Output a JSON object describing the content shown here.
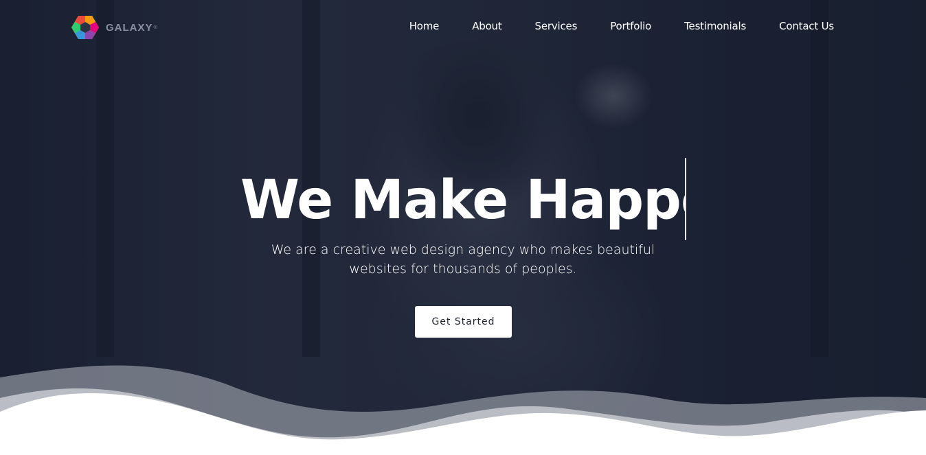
{
  "brand": {
    "name": "GALAXY",
    "registered_mark": "®"
  },
  "nav": {
    "items": [
      {
        "label": "Home"
      },
      {
        "label": "About"
      },
      {
        "label": "Services"
      },
      {
        "label": "Portfolio"
      },
      {
        "label": "Testimonials"
      },
      {
        "label": "Contact Us"
      }
    ]
  },
  "hero": {
    "headline": "We Make Happe",
    "subtitle_line1": "We are a creative web design agency who makes beautiful",
    "subtitle_line2": "websites for thousands of peoples.",
    "cta_label": "Get Started"
  },
  "colors": {
    "overlay": "#1f2637",
    "wave_light": "#c8cad1",
    "wave_mid": "#8c909c",
    "white": "#ffffff"
  },
  "icons": {
    "logo": "hexagon-logo-icon"
  }
}
